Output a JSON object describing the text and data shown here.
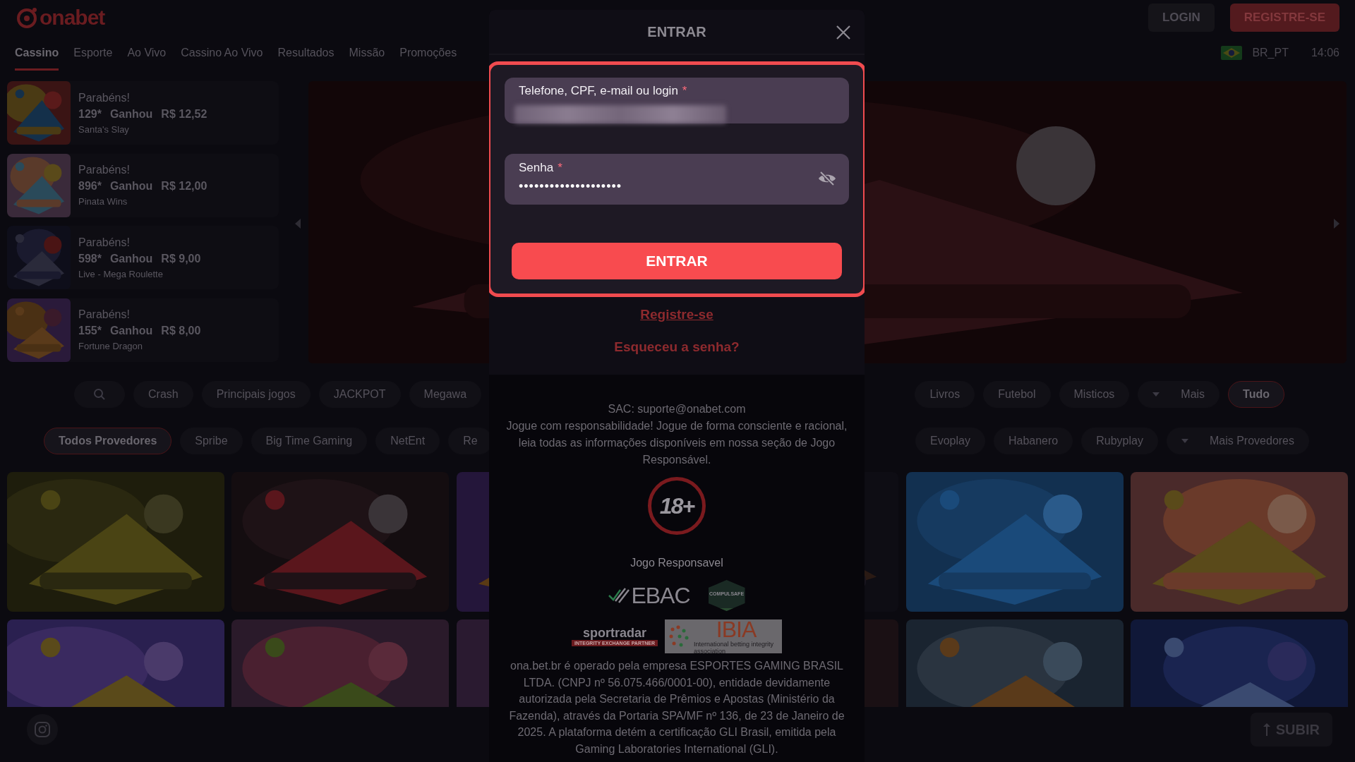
{
  "header": {
    "logo": "onabet",
    "buttons": [
      {
        "label": "LOGIN",
        "kind": "secondary"
      },
      {
        "label": "REGISTRE-SE",
        "kind": "primary"
      }
    ]
  },
  "nav": {
    "tabs": [
      {
        "label": "Cassino",
        "selected": true
      },
      {
        "label": "Esporte",
        "selected": false
      },
      {
        "label": "Ao Vivo",
        "selected": false
      },
      {
        "label": "Cassino Ao Vivo",
        "selected": false
      },
      {
        "label": "Resultados",
        "selected": false
      },
      {
        "label": "Missão",
        "selected": false
      },
      {
        "label": "Promoções",
        "selected": false
      }
    ],
    "locale": "BR_PT",
    "time": "14:06"
  },
  "winners": [
    {
      "title": "Parabéns!",
      "multiplier": "129*",
      "action": "Ganhou",
      "amount": "R$ 12,52",
      "game": "Santa's Slay"
    },
    {
      "title": "Parabéns!",
      "multiplier": "896*",
      "action": "Ganhou",
      "amount": "R$ 12,00",
      "game": "Pinata Wins"
    },
    {
      "title": "Parabéns!",
      "multiplier": "598*",
      "action": "Ganhou",
      "amount": "R$ 9,00",
      "game": "Live - Mega Roulette"
    },
    {
      "title": "Parabéns!",
      "multiplier": "155*",
      "action": "Ganhou",
      "amount": "R$ 8,00",
      "game": "Fortune Dragon"
    }
  ],
  "categories": {
    "left": [
      {
        "kind": "search",
        "selected": false
      },
      {
        "label": "Crash",
        "kind": "chip",
        "selected": false
      },
      {
        "label": "Principais jogos",
        "kind": "chip",
        "selected": false
      },
      {
        "label": "JACKPOT",
        "kind": "chip",
        "selected": false
      },
      {
        "label": "Megawa",
        "kind": "chip",
        "selected": false
      }
    ],
    "right": [
      {
        "label": "Livros",
        "kind": "chip",
        "selected": false
      },
      {
        "label": "Futebol",
        "kind": "chip",
        "selected": false
      },
      {
        "label": "Misticos",
        "kind": "chip",
        "selected": false
      },
      {
        "label": "Mais",
        "kind": "dropdown",
        "selected": false
      },
      {
        "label": "Tudo",
        "kind": "chip",
        "selected": true
      }
    ]
  },
  "providers": {
    "left": [
      {
        "label": "Todos Provedores",
        "kind": "chip",
        "selected": true
      },
      {
        "label": "Spribe",
        "kind": "chip",
        "selected": false
      },
      {
        "label": "Big Time Gaming",
        "kind": "chip",
        "selected": false
      },
      {
        "label": "NetEnt",
        "kind": "chip",
        "selected": false
      },
      {
        "label": "Re",
        "kind": "chip",
        "selected": false
      }
    ],
    "right": [
      {
        "label": "Evoplay",
        "kind": "chip",
        "selected": false
      },
      {
        "label": "Habanero",
        "kind": "chip",
        "selected": false
      },
      {
        "label": "Rubyplay",
        "kind": "chip",
        "selected": false
      },
      {
        "label": "Mais Provedores",
        "kind": "dropdown",
        "selected": false
      }
    ]
  },
  "bottom": {
    "scroll_top": "SUBIR"
  },
  "modal": {
    "title": "ENTRAR",
    "form_highlighted": true,
    "fields": [
      {
        "label": "Telefone, CPF, e-mail ou login",
        "required": true,
        "required_mark": "*",
        "redacted": true
      },
      {
        "label": "Senha",
        "required": true,
        "required_mark": "*",
        "value": "••••••••••••••••••••",
        "revealed": false
      }
    ],
    "submit": "ENTRAR",
    "register_link": "Registre-se",
    "forgot_link": "Esqueceu a senha?",
    "support": "SAC: suporte@onabet.com",
    "notice": "Jogue com responsabilidade! Jogue de forma consciente e racional, leia todas as informações disponíveis em nossa seção de Jogo Responsável.",
    "age_badge": "18+",
    "responsible_label": "Jogo Responsavel",
    "partners": [
      {
        "kind": "ebac",
        "name": "EBAC"
      },
      {
        "kind": "compulsafe",
        "name": "COMPULSAFE"
      },
      {
        "kind": "sportradar",
        "name": "sportradar",
        "tagline": "INTEGRITY EXCHANGE PARTNER"
      },
      {
        "kind": "ibia",
        "name": "IBIA",
        "tagline": "International betting integrity association"
      }
    ],
    "legal": "ona.bet.br é operado pela empresa ESPORTES GAMING BRASIL LTDA. (CNPJ nº 56.075.466/0001-00), entidade devidamente autorizada pela Secretaria de Prêmios e Apostas (Ministério da Fazenda), através da Portaria SPA/MF nº 136, de 23 de Janeiro de 2025. A plataforma detém a certificação GLI Brasil, emitida pela Gaming Laboratories International (GLI)."
  }
}
